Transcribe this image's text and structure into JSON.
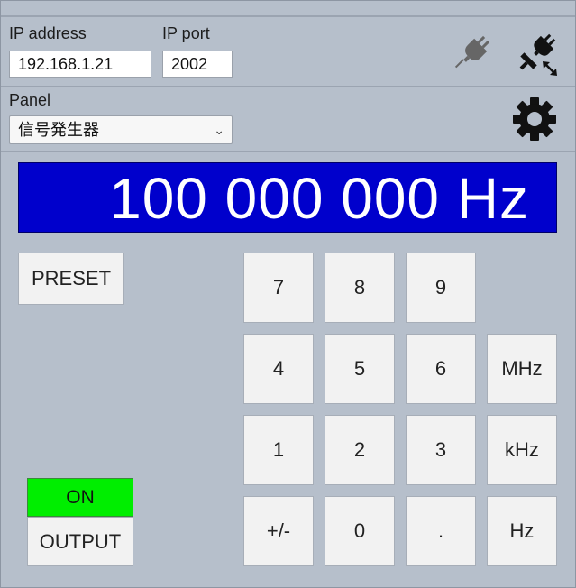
{
  "connection": {
    "ip_address_label": "IP address",
    "ip_address_value": "192.168.1.21",
    "ip_port_label": "IP port",
    "ip_port_value": "2002",
    "icons": [
      "plug-disconnected-icon",
      "plug-connect-icon"
    ]
  },
  "panel": {
    "label": "Panel",
    "selected": "信号発生器",
    "settings_icon": "gear-icon"
  },
  "display": {
    "frequency": "100 000 000 Hz",
    "color": "#0000cc"
  },
  "buttons": {
    "preset": "PRESET",
    "on": "ON",
    "output": "OUTPUT",
    "on_color": "#00ee00"
  },
  "keypad": {
    "k7": "7",
    "k8": "8",
    "k9": "9",
    "k4": "4",
    "k5": "5",
    "k6": "6",
    "mhz": "MHz",
    "k1": "1",
    "k2": "2",
    "k3": "3",
    "khz": "kHz",
    "sign": "+/-",
    "k0": "0",
    "dot": ".",
    "hz": "Hz"
  }
}
